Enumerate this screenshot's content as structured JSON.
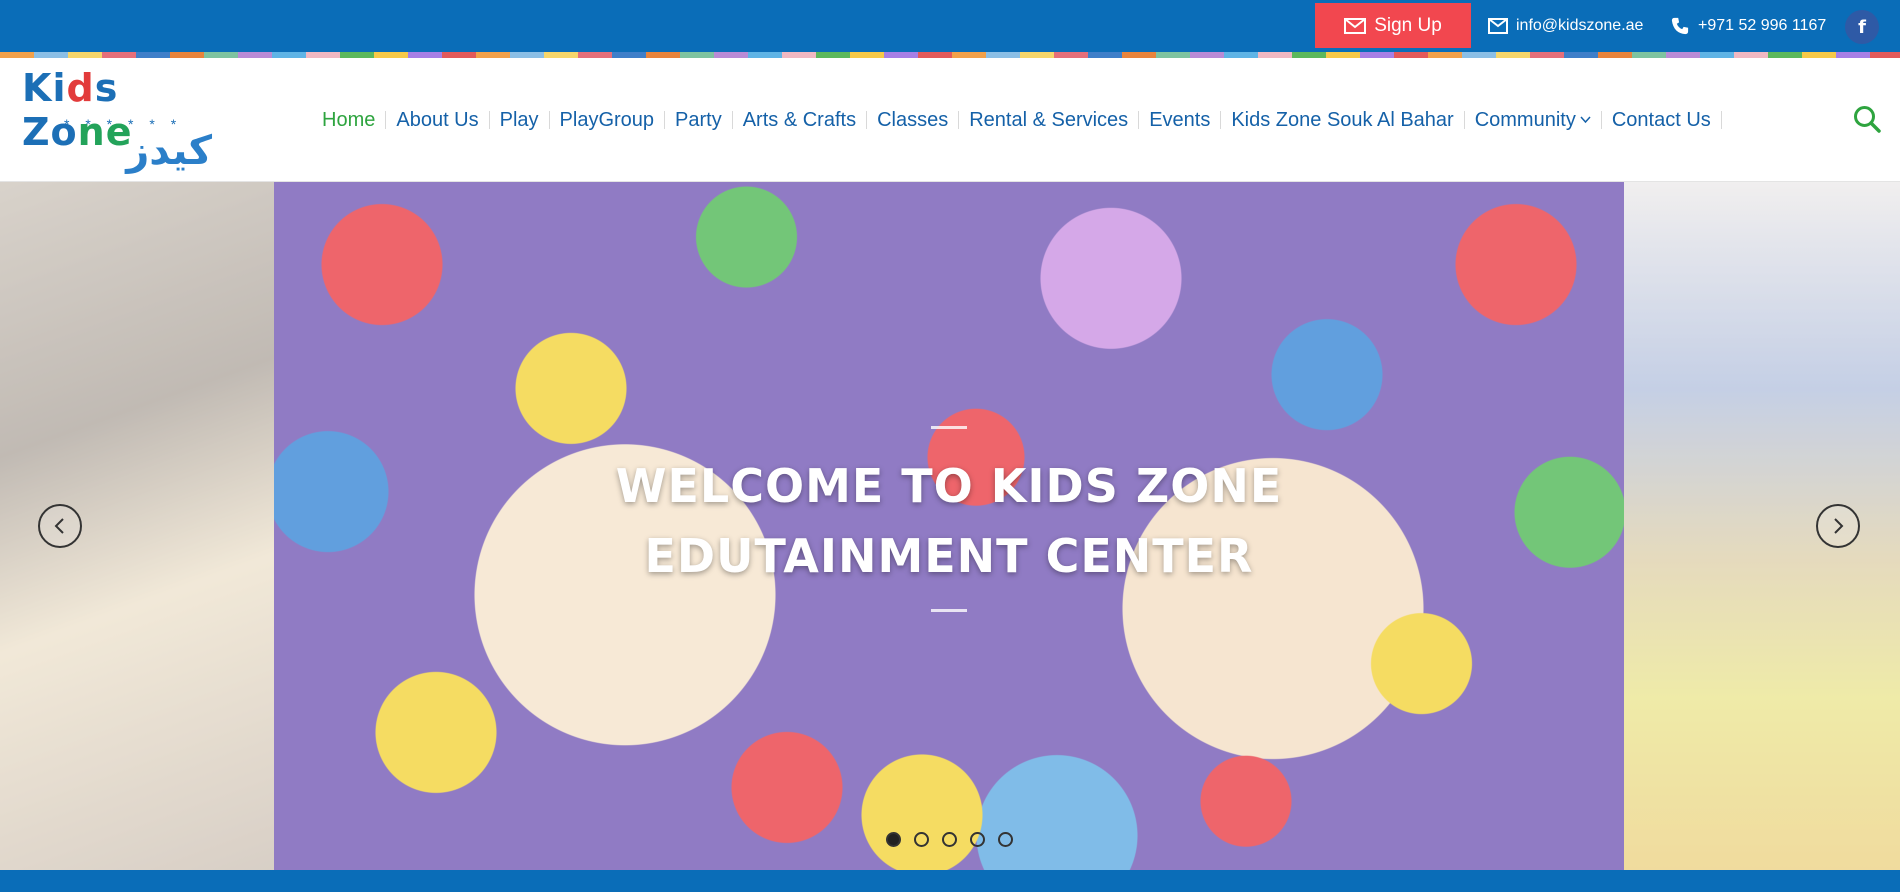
{
  "topbar": {
    "signup_label": "Sign Up",
    "email": "info@kidszone.ae",
    "phone": "+971 52 996 1167",
    "facebook_glyph": "f",
    "background_color": "#0a6db8",
    "signup_color": "#f2474f"
  },
  "logo": {
    "title_parts": [
      "Ki",
      "d",
      "s Zo",
      "ne"
    ],
    "stars": "* * * * * *",
    "arabic": "كيدز زون"
  },
  "nav": {
    "items": [
      {
        "label": "Home",
        "active": true
      },
      {
        "label": "About Us"
      },
      {
        "label": "Play"
      },
      {
        "label": "PlayGroup"
      },
      {
        "label": "Party"
      },
      {
        "label": "Arts & Crafts"
      },
      {
        "label": "Classes"
      },
      {
        "label": "Rental & Services"
      },
      {
        "label": "Events"
      },
      {
        "label": "Kids Zone Souk Al Bahar"
      },
      {
        "label": "Community",
        "has_dropdown": true
      },
      {
        "label": "Contact Us"
      }
    ],
    "active_color": "#2ea43f",
    "link_color": "#1561a8"
  },
  "slider": {
    "caption_line1": "WELCOME TO KIDS ZONE",
    "caption_line2": "EDUTAINMENT CENTER",
    "slide_count": 5,
    "active_slide": 1
  },
  "icons": {
    "signup": "mail-icon",
    "email": "mail-icon",
    "phone": "phone-icon",
    "facebook": "facebook-icon",
    "search": "search-icon",
    "prev": "chevron-left-icon",
    "next": "chevron-right-icon",
    "dropdown": "chevron-down-icon"
  }
}
